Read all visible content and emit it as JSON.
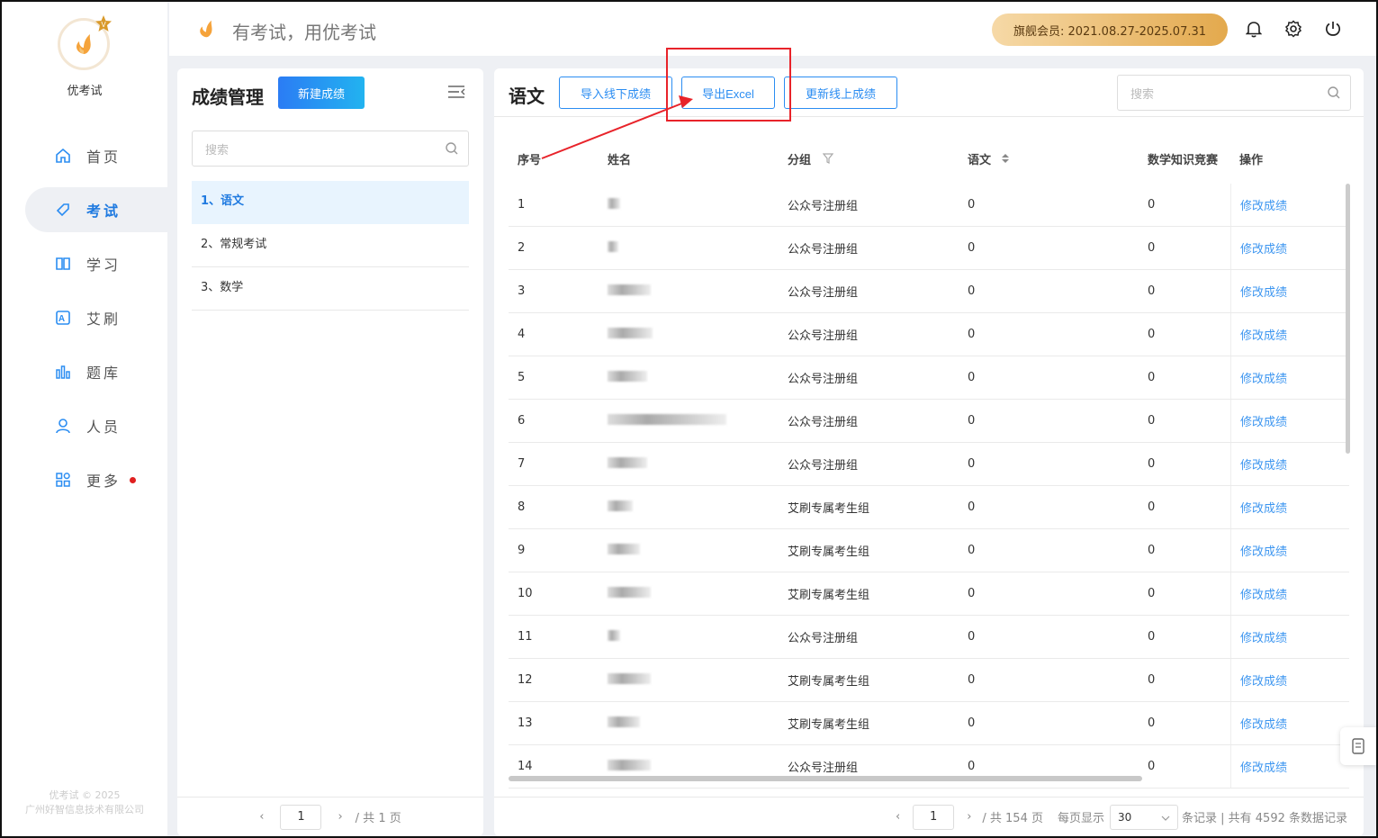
{
  "app": {
    "name": "优考试",
    "slogan": "有考试，用优考试",
    "copyright_line1": "优考试 © 2025",
    "copyright_line2": "广州好智信息技术有限公司"
  },
  "nav": [
    {
      "label": "首页",
      "icon": "home-icon"
    },
    {
      "label": "考试",
      "icon": "exam-tag-icon",
      "active": true
    },
    {
      "label": "学习",
      "icon": "book-icon"
    },
    {
      "label": "艾刷",
      "icon": "a-box-icon"
    },
    {
      "label": "题库",
      "icon": "bars-icon"
    },
    {
      "label": "人员",
      "icon": "user-icon"
    },
    {
      "label": "更多",
      "icon": "apps-icon",
      "dot": true
    }
  ],
  "vip": {
    "label": "旗舰会员: 2021.08.27-2025.07.31"
  },
  "left_panel": {
    "title": "成绩管理",
    "new_button": "新建成绩",
    "search_placeholder": "搜索",
    "items": [
      "1、语文",
      "2、常规考试",
      "3、数学"
    ],
    "page_current": "1",
    "page_total_text": "/ 共 1 页"
  },
  "main_panel": {
    "title": "语文",
    "buttons": {
      "import_offline": "导入线下成绩",
      "export_excel": "导出Excel",
      "update_online": "更新线上成绩"
    },
    "search_placeholder": "搜索",
    "columns": [
      "序号",
      "姓名",
      "分组",
      "语文",
      "数学知识竞赛",
      "操作"
    ],
    "rows": [
      {
        "no": "1",
        "group": "公众号注册组",
        "chinese": "0",
        "math": "0",
        "action": "修改成绩"
      },
      {
        "no": "2",
        "group": "公众号注册组",
        "chinese": "0",
        "math": "0",
        "action": "修改成绩"
      },
      {
        "no": "3",
        "group": "公众号注册组",
        "chinese": "0",
        "math": "0",
        "action": "修改成绩"
      },
      {
        "no": "4",
        "group": "公众号注册组",
        "chinese": "0",
        "math": "0",
        "action": "修改成绩"
      },
      {
        "no": "5",
        "group": "公众号注册组",
        "chinese": "0",
        "math": "0",
        "action": "修改成绩"
      },
      {
        "no": "6",
        "group": "公众号注册组",
        "chinese": "0",
        "math": "0",
        "action": "修改成绩"
      },
      {
        "no": "7",
        "group": "公众号注册组",
        "chinese": "0",
        "math": "0",
        "action": "修改成绩"
      },
      {
        "no": "8",
        "group": "艾刷专属考生组",
        "chinese": "0",
        "math": "0",
        "action": "修改成绩"
      },
      {
        "no": "9",
        "group": "艾刷专属考生组",
        "chinese": "0",
        "math": "0",
        "action": "修改成绩"
      },
      {
        "no": "10",
        "group": "艾刷专属考生组",
        "chinese": "0",
        "math": "0",
        "action": "修改成绩"
      },
      {
        "no": "11",
        "group": "公众号注册组",
        "chinese": "0",
        "math": "0",
        "action": "修改成绩"
      },
      {
        "no": "12",
        "group": "艾刷专属考生组",
        "chinese": "0",
        "math": "0",
        "action": "修改成绩"
      },
      {
        "no": "13",
        "group": "艾刷专属考生组",
        "chinese": "0",
        "math": "0",
        "action": "修改成绩"
      },
      {
        "no": "14",
        "group": "公众号注册组",
        "chinese": "0",
        "math": "0",
        "action": "修改成绩"
      }
    ],
    "pagination": {
      "current": "1",
      "total_text": "/ 共 154 页",
      "per_page_label": "每页显示",
      "per_page_value": "30",
      "summary": "条记录 | 共有 4592 条数据记录"
    }
  },
  "colors": {
    "accent": "#2b8df2",
    "annotation": "#e8232a"
  }
}
